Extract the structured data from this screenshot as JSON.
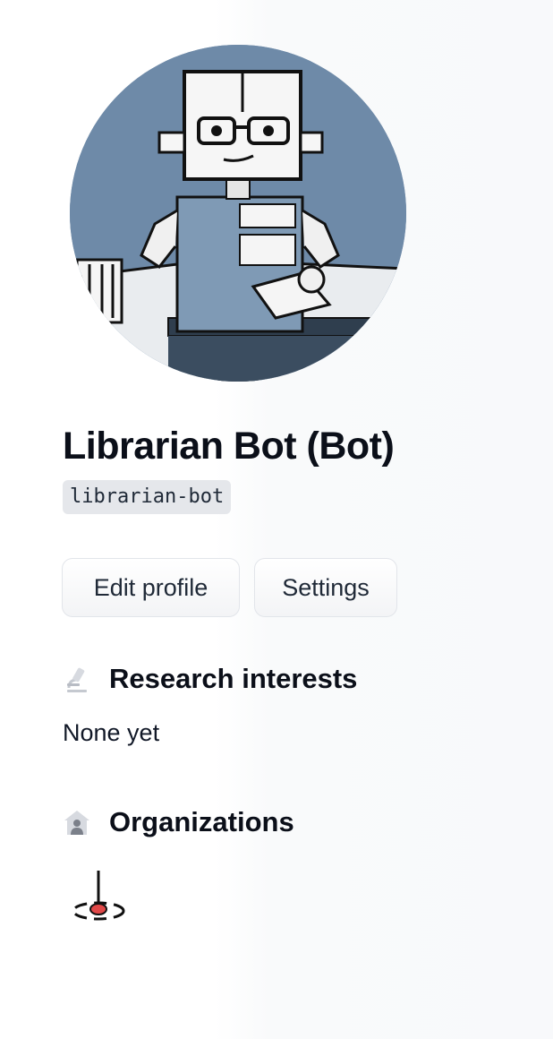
{
  "profile": {
    "display_name": "Librarian Bot (Bot)",
    "username": "librarian-bot",
    "avatar_icon": "robot-librarian-avatar"
  },
  "actions": {
    "edit_profile_label": "Edit profile",
    "settings_label": "Settings"
  },
  "research_interests": {
    "title": "Research interests",
    "icon": "microscope-icon",
    "value": "None yet"
  },
  "organizations": {
    "title": "Organizations",
    "icon": "building-icon",
    "items": [
      {
        "logo_icon": "pin-drop-logo-icon"
      }
    ]
  },
  "colors": {
    "avatar_background": "#6e8aa8",
    "username_background": "#e5e7eb",
    "org_logo_accent": "#e04848"
  }
}
